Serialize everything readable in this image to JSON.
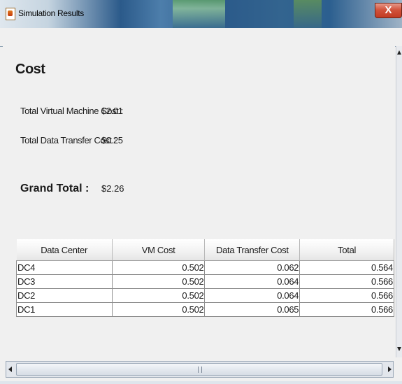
{
  "window": {
    "title": "Simulation Results",
    "close_label": "X"
  },
  "cost": {
    "heading": "Cost",
    "vm_cost_label": "Total Virtual Machine Cost :",
    "vm_cost_value": "$2.01",
    "transfer_cost_label": "Total Data Transfer Cost :",
    "transfer_cost_value": "$0.25",
    "grand_total_label": "Grand Total :",
    "grand_total_value": "$2.26"
  },
  "table": {
    "columns": [
      "Data Center",
      "VM Cost",
      "Data Transfer Cost",
      "Total"
    ],
    "rows": [
      [
        "DC4",
        "0.502",
        "0.062",
        "0.564"
      ],
      [
        "DC3",
        "0.502",
        "0.064",
        "0.566"
      ],
      [
        "DC2",
        "0.502",
        "0.064",
        "0.566"
      ],
      [
        "DC1",
        "0.502",
        "0.065",
        "0.566"
      ]
    ]
  }
}
